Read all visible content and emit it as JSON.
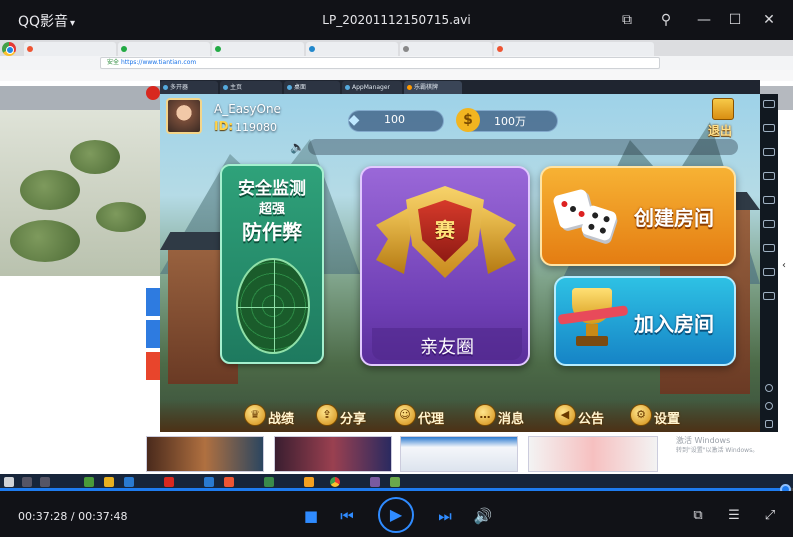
{
  "player": {
    "brand": "QQ影音",
    "filename": "LP_20201112150715.avi",
    "time_current": "00:37:28",
    "time_total": "00:37:48",
    "progress": 0.991
  },
  "browser": {
    "url": "https://www.tiantian.com",
    "secure": "安全"
  },
  "emulator": {
    "tabs": [
      "多开器",
      "主页",
      "桌面",
      "AppManager",
      "乐霸棋牌"
    ]
  },
  "game": {
    "username": "A_EasyOne",
    "id_label": "ID:",
    "id_value": "119080",
    "diamonds": "100",
    "coins": "100万",
    "coin_glyph": "$",
    "exit_label": "退出",
    "anti_cheat_line1": "安全监测",
    "anti_cheat_line2": "超强",
    "anti_cheat_line3": "防作弊",
    "friends_label": "亲友圈",
    "match_glyph": "赛",
    "create_room": "创建房间",
    "join_room": "加入房间",
    "menu": [
      {
        "label": "战绩",
        "icon": "trophy-icon"
      },
      {
        "label": "分享",
        "icon": "share-icon"
      },
      {
        "label": "代理",
        "icon": "agent-icon"
      },
      {
        "label": "消息",
        "icon": "message-icon"
      },
      {
        "label": "公告",
        "icon": "announcement-icon"
      },
      {
        "label": "设置",
        "icon": "settings-icon"
      }
    ]
  },
  "desktop": {
    "watermark_line1": "激活 Windows",
    "watermark_line2": "转到\"设置\"以激活 Windows。"
  },
  "colors": {
    "accent": "#2f8bff",
    "titlebar": "#111217",
    "gold": "#ffd34a"
  }
}
